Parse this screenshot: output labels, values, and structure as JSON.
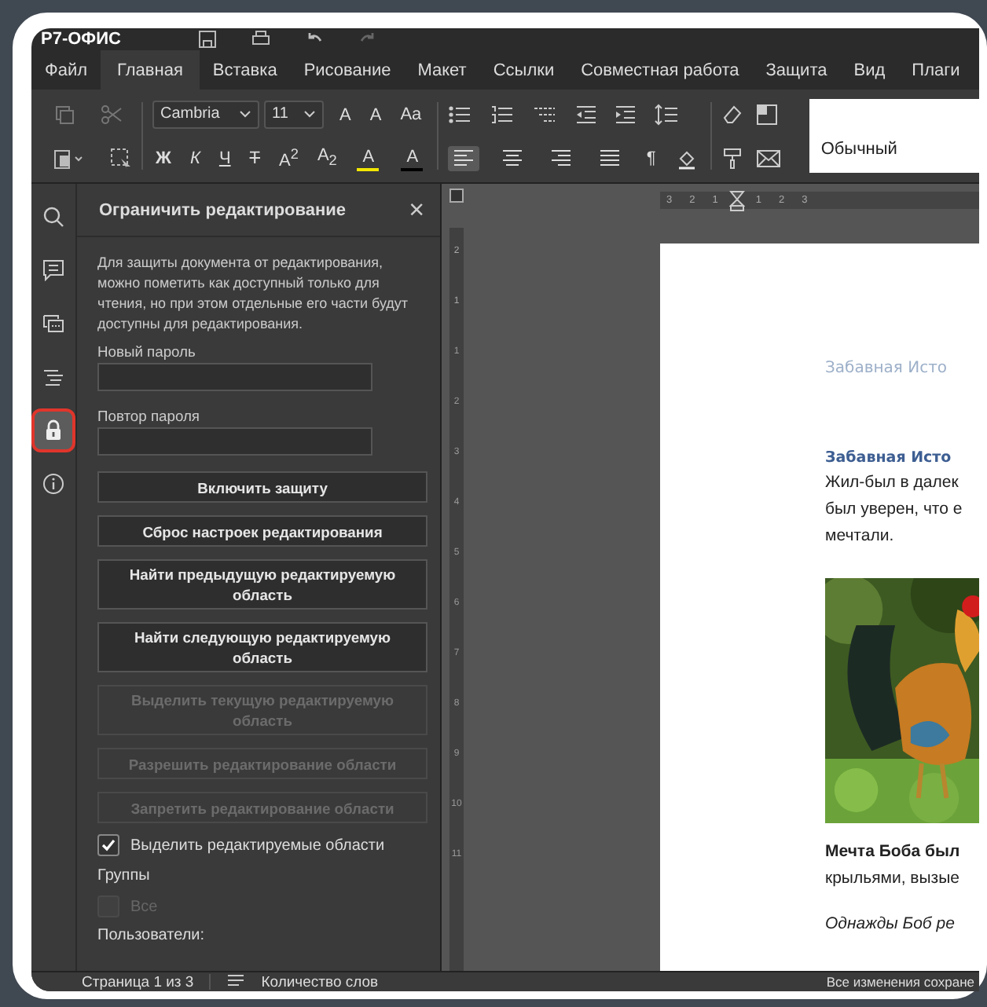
{
  "app": {
    "title": "Р7-ОФИС"
  },
  "menu_tabs": [
    {
      "label": "Файл",
      "selected": false
    },
    {
      "label": "Главная",
      "selected": true
    },
    {
      "label": "Вставка",
      "selected": false
    },
    {
      "label": "Рисование",
      "selected": false
    },
    {
      "label": "Макет",
      "selected": false
    },
    {
      "label": "Ссылки",
      "selected": false
    },
    {
      "label": "Совместная работа",
      "selected": false
    },
    {
      "label": "Защита",
      "selected": false
    },
    {
      "label": "Вид",
      "selected": false
    },
    {
      "label": "Плаги",
      "selected": false
    }
  ],
  "toolbar": {
    "font": "Cambria",
    "font_size": "11",
    "style": "Обычный",
    "case_buttons": [
      "A",
      "A",
      "Aa"
    ],
    "format_buttons": [
      {
        "label": "Ж",
        "kind": "bold"
      },
      {
        "label": "К",
        "kind": "italic"
      },
      {
        "label": "Ч",
        "kind": "underline"
      },
      {
        "label": "Т",
        "kind": "strike"
      },
      {
        "label": "A$^{2}$",
        "kind": "plain"
      },
      {
        "label": "A$_{2}$",
        "kind": "plain"
      }
    ],
    "color_buttons": [
      {
        "label": "A",
        "color": "#f2e600"
      },
      {
        "label": "A",
        "color": "#000000"
      }
    ],
    "align_buttons": [
      {
        "kind": "left",
        "selected": true
      },
      {
        "kind": "center",
        "selected": false
      },
      {
        "kind": "right",
        "selected": false
      },
      {
        "kind": "justify",
        "selected": false
      }
    ],
    "pilcrow": "¶"
  },
  "left_bar": [
    {
      "kind": "search",
      "selected": false
    },
    {
      "kind": "comment",
      "selected": false
    },
    {
      "kind": "chat",
      "selected": false
    },
    {
      "kind": "navigation",
      "selected": false
    },
    {
      "kind": "lock",
      "selected": true
    },
    {
      "kind": "info",
      "selected": false
    }
  ],
  "panel": {
    "title": "Ограничить редактирование",
    "close": "×",
    "description": "Для защиты документа от редактирования, можно пометить как доступный только для чтения, но при этом отдельные его части будут доступны для редактирования.",
    "fields": [
      {
        "label": "Новый пароль"
      },
      {
        "label": "Повтор пароля"
      }
    ],
    "buttons": [
      {
        "label": "Включить защиту",
        "disabled": false
      },
      {
        "label": "Сброс настроек редактирования",
        "disabled": false
      },
      {
        "label": "Найти предыдущую редактируемую область",
        "disabled": false
      },
      {
        "label": "Найти следующую редактируемую область",
        "disabled": false
      },
      {
        "label": "Выделить текущую редактируемую область",
        "disabled": true
      },
      {
        "label": "Разрешить редактирование области",
        "disabled": true
      },
      {
        "label": "Запретить редактирование области",
        "disabled": true
      }
    ],
    "highlight_checkbox": {
      "label": "Выделить редактируемые области",
      "checked": true
    },
    "groups_label": "Группы",
    "groups": [
      {
        "label": "Все",
        "checked": false,
        "disabled": true
      }
    ],
    "users_label": "Пользователи:"
  },
  "rulers": {
    "horizontal": [
      "3",
      "2",
      "1",
      "1",
      "2",
      "3"
    ],
    "vertical": [
      "2",
      "1",
      "1",
      "2",
      "3",
      "4",
      "5",
      "6",
      "7",
      "8",
      "9",
      "10",
      "11"
    ]
  },
  "document": {
    "header": "Забавная Исто",
    "heading": "Забавная Исто",
    "paragraph": "Жил-был в далек\nбыл уверен, что е\nмечтали.",
    "caption": "**Мечта Боба был**\nкрыльями, вызые",
    "italic_line": "Однажды Боб ре"
  },
  "status_bar": {
    "page": "Страница 1 из 3",
    "word_count": "Количество слов",
    "saved": "Все изменения сохране"
  }
}
